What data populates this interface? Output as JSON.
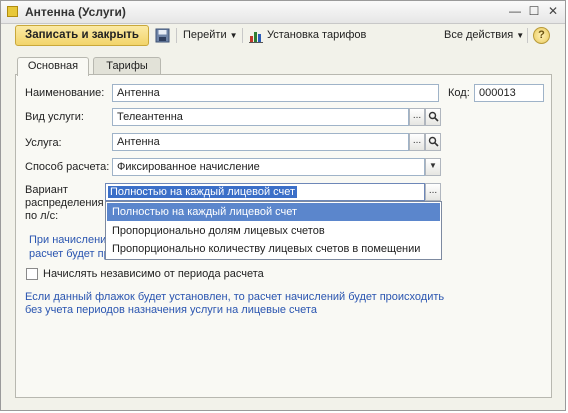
{
  "window": {
    "title": "Антенна (Услуги)",
    "controls": {
      "minimize": "—",
      "maximize": "☐",
      "close": "✕"
    }
  },
  "toolbar": {
    "save_close_label": "Записать и закрыть",
    "goto_label": "Перейти",
    "tariffs_label": "Установка тарифов",
    "all_actions_label": "Все действия",
    "help_label": "?"
  },
  "tabs": [
    {
      "label": "Основная",
      "active": true
    },
    {
      "label": "Тарифы",
      "active": false
    }
  ],
  "form": {
    "name_label": "Наименование:",
    "name_value": "Антенна",
    "code_label": "Код:",
    "code_value": "000013",
    "service_type_label": "Вид услуги:",
    "service_type_value": "Телеантенна",
    "service_label": "Услуга:",
    "service_value": "Антенна",
    "calc_method_label": "Способ расчета:",
    "calc_method_value": "Фиксированное начисление",
    "distribution_label_1": "Вариант",
    "distribution_label_2": "распределения",
    "distribution_label_3": "по л/с:",
    "distribution_value": "Полностью на каждый лицевой счет",
    "ellipsis": "...",
    "search_icon": "magnifier-icon"
  },
  "dropdown": {
    "options": [
      "Полностью на каждый лицевой счет",
      "Пропорционально долям лицевых счетов",
      "Пропорционально количеству лицевых счетов в помещении"
    ],
    "selected_index": 0
  },
  "info": {
    "partial_line1": "При начислени",
    "partial_line2": "расчет будет пр",
    "checkbox_label": "Начислять независимо от периода расчета",
    "checkbox_checked": false,
    "hint_line1": "Если данный флажок будет установлен, то расчет начислений будет происходить",
    "hint_line2": "без учета периодов назначения услуги на лицевые счета"
  },
  "colors": {
    "accent_button": "#f2d46a",
    "hint_text": "#2a55b0",
    "selection": "#5b86cc"
  }
}
